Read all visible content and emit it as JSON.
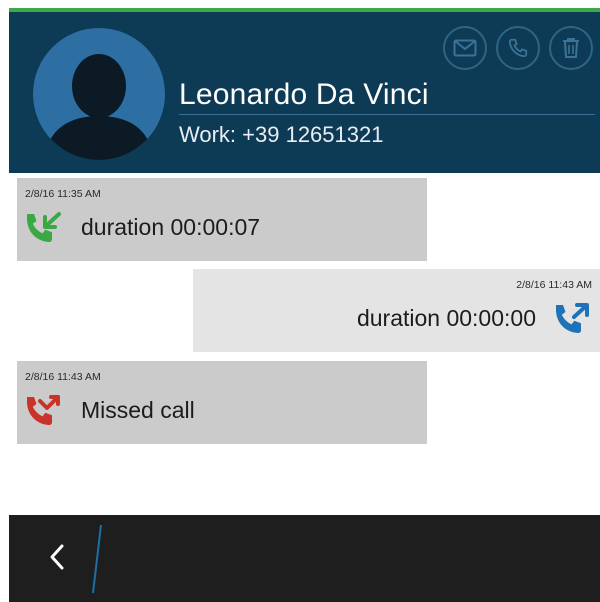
{
  "contact": {
    "name": "Leonardo Da Vinci",
    "phone": "Work: +39 12651321",
    "avatar_icon": "person-silhouette-icon"
  },
  "header_actions": [
    {
      "name": "message",
      "icon": "envelope-icon"
    },
    {
      "name": "call",
      "icon": "phone-icon"
    },
    {
      "name": "delete",
      "icon": "trash-icon"
    }
  ],
  "call_log": [
    {
      "type": "incoming",
      "timestamp": "2/8/16 11:35 AM",
      "text": "duration 00:00:07",
      "icon": "incoming-call-icon",
      "icon_color": "#3aa845"
    },
    {
      "type": "outgoing",
      "timestamp": "2/8/16 11:43 AM",
      "text": "duration 00:00:00",
      "icon": "outgoing-call-icon",
      "icon_color": "#1f72b8"
    },
    {
      "type": "missed",
      "timestamp": "2/8/16 11:43 AM",
      "text": "Missed call",
      "icon": "missed-call-icon",
      "icon_color": "#c9332b"
    }
  ],
  "bottom_bar": {
    "back_icon": "chevron-left-icon"
  },
  "colors": {
    "header_bg": "#0d3a55",
    "accent_green": "#3da84a",
    "bottom_bar_bg": "#1e1e1e"
  }
}
